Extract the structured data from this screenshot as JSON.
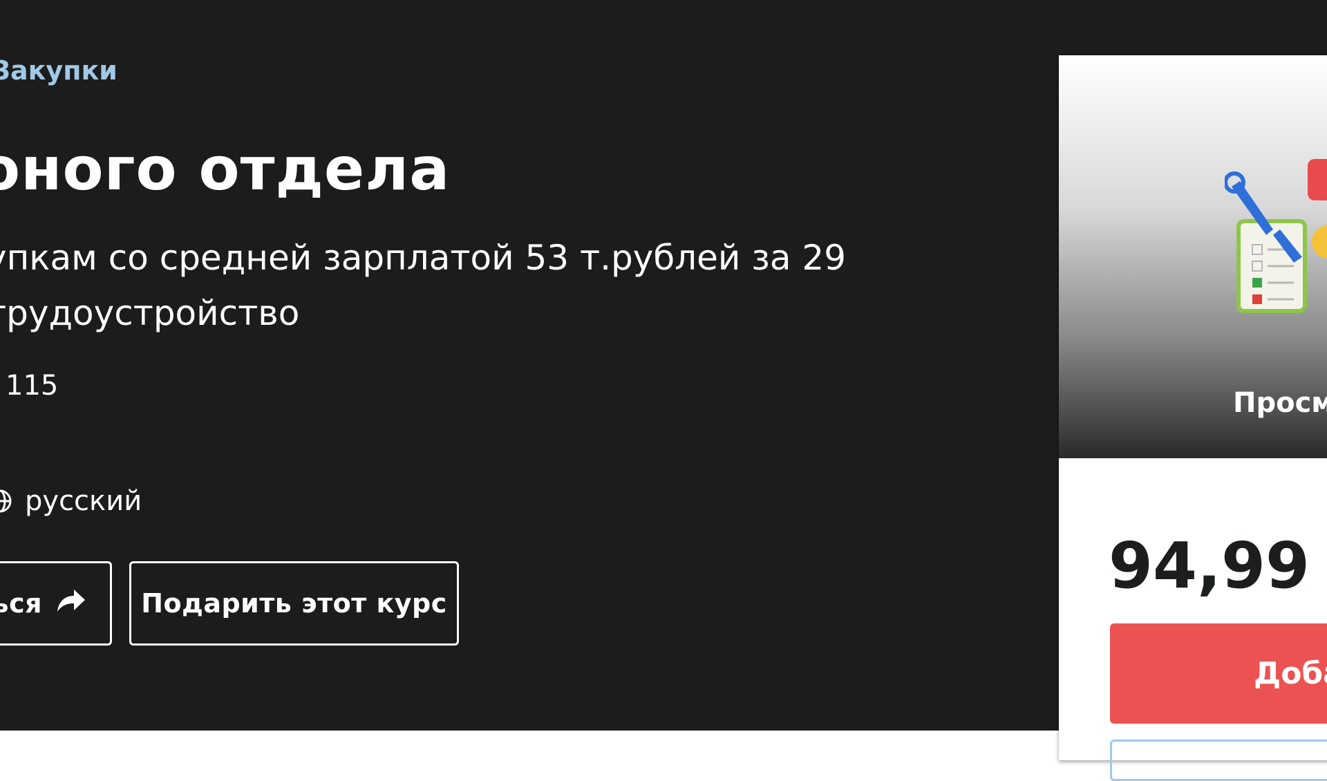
{
  "hero": {
    "breadcrumb": "Закупки",
    "title": "оного отдела",
    "subtitle_line1": "упкам со средней зарплатой 53 т.рублей за 29",
    "subtitle_line2": "трудоустройство",
    "rating_count": "115",
    "language": "русский",
    "language_icon": "globe-icon",
    "share_label": "ься",
    "share_icon": "share-arrow-icon",
    "gift_label": "Подарить этот курс"
  },
  "sidebar_card": {
    "preview_label": "Просм",
    "price": "94,99 $",
    "add_button_label": "Доба"
  },
  "colors": {
    "hero_bg": "#1c1c1c",
    "breadcrumb": "#a1c9e6",
    "add_button": "#ec5252"
  }
}
